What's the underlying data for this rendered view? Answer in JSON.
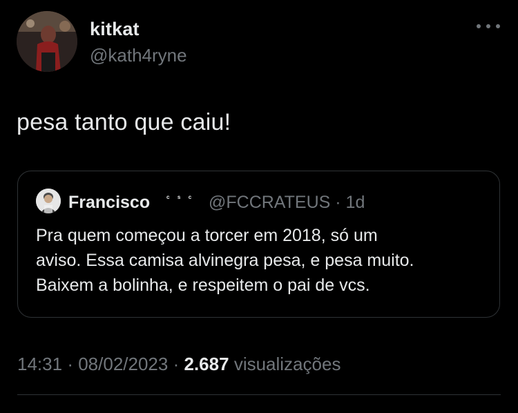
{
  "tweet": {
    "author_name": "kitkat",
    "author_handle": "@kath4ryne",
    "text": "pesa tanto que caiu!",
    "more_icon": "more-horizontal-icon"
  },
  "quote": {
    "author_name": "Francisco",
    "author_name_suffix": "ᶜ ˢ ᶜ",
    "author_handle": "@FCCRATEUS",
    "separator": "·",
    "time": "1d",
    "text_lines": [
      "Pra quem começou a torcer em 2018, só um",
      "aviso. Essa camisa alvinegra pesa, e pesa muito.",
      "Baixem a bolinha, e respeitem o pai de vcs."
    ]
  },
  "footer": {
    "time": "14:31",
    "sep1": "·",
    "date": "08/02/2023",
    "sep2": "·",
    "views_count": "2.687",
    "views_label": "visualizações"
  },
  "colors": {
    "background": "#000000",
    "primary_text": "#e7e9ea",
    "secondary_text": "#71767b",
    "border": "#2f3336"
  }
}
